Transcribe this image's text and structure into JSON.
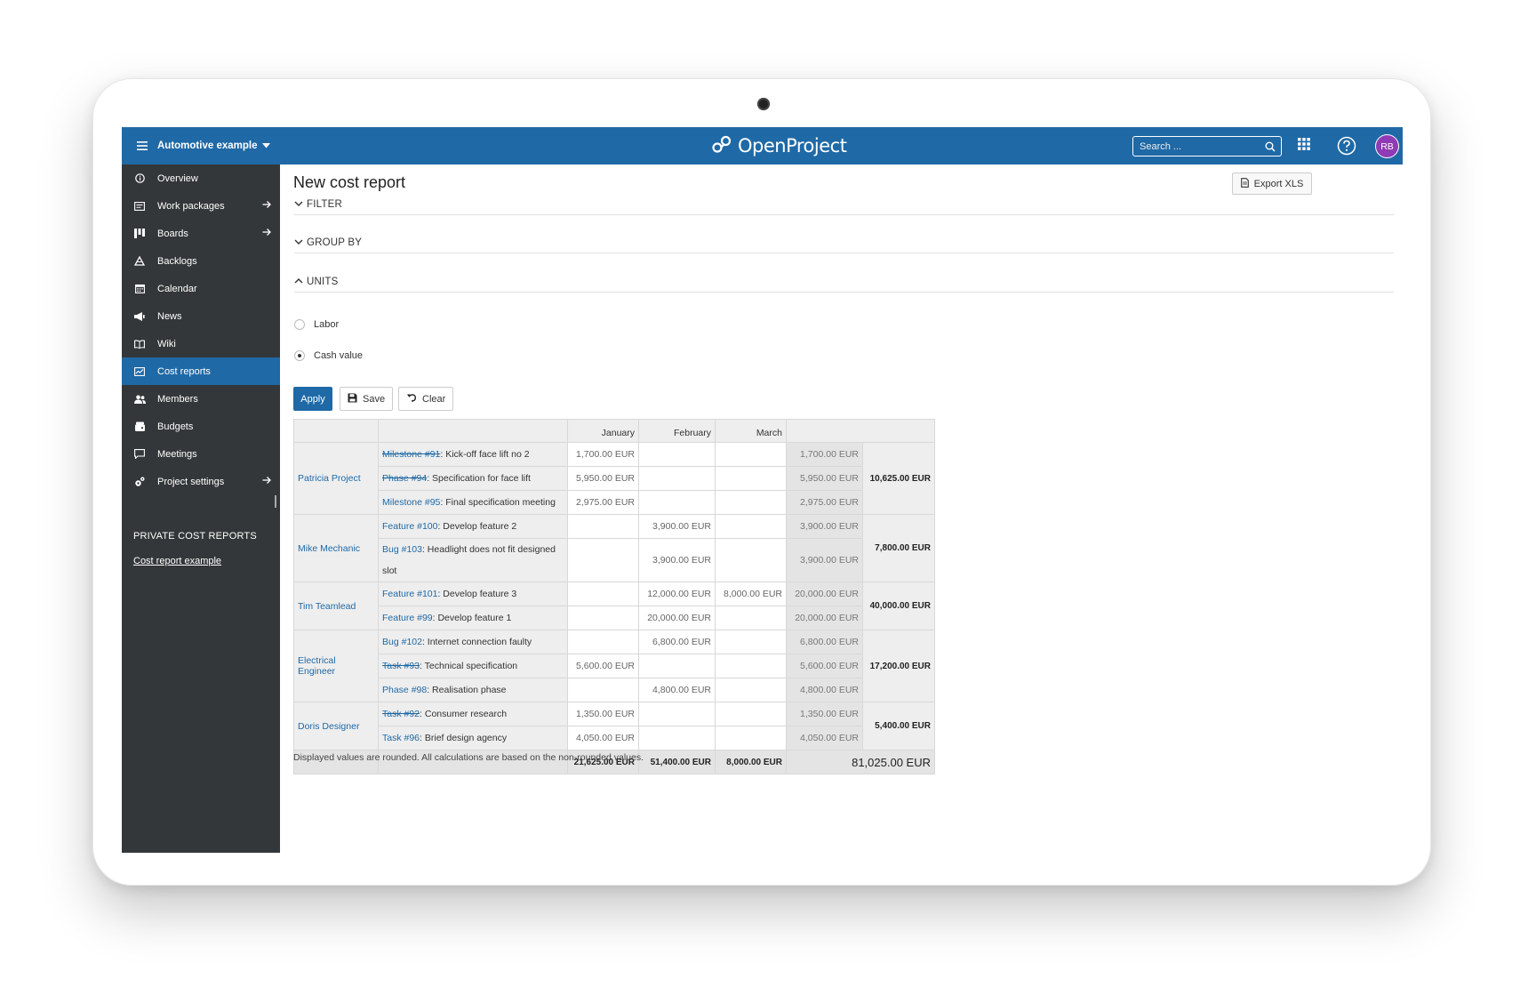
{
  "header": {
    "project_name": "Automotive example",
    "logo_text": "OpenProject",
    "search_placeholder": "Search ...",
    "avatar_initials": "RB"
  },
  "sidebar": {
    "items": [
      {
        "label": "Overview",
        "icon": "info-icon",
        "arrow": false,
        "active": false
      },
      {
        "label": "Work packages",
        "icon": "work-packages-icon",
        "arrow": true,
        "active": false
      },
      {
        "label": "Boards",
        "icon": "boards-icon",
        "arrow": true,
        "active": false
      },
      {
        "label": "Backlogs",
        "icon": "backlogs-icon",
        "arrow": false,
        "active": false
      },
      {
        "label": "Calendar",
        "icon": "calendar-icon",
        "arrow": false,
        "active": false
      },
      {
        "label": "News",
        "icon": "news-icon",
        "arrow": false,
        "active": false
      },
      {
        "label": "Wiki",
        "icon": "wiki-icon",
        "arrow": false,
        "active": false
      },
      {
        "label": "Cost reports",
        "icon": "cost-reports-icon",
        "arrow": false,
        "active": true
      },
      {
        "label": "Members",
        "icon": "members-icon",
        "arrow": false,
        "active": false
      },
      {
        "label": "Budgets",
        "icon": "budgets-icon",
        "arrow": false,
        "active": false
      },
      {
        "label": "Meetings",
        "icon": "meetings-icon",
        "arrow": false,
        "active": false
      },
      {
        "label": "Project settings",
        "icon": "settings-icon",
        "arrow": true,
        "active": false
      }
    ],
    "private_title": "PRIVATE COST REPORTS",
    "private_link": "Cost report example"
  },
  "main": {
    "title": "New cost report",
    "export_label": "Export XLS",
    "sections": {
      "filter": "FILTER",
      "group_by": "GROUP BY",
      "units": "UNITS"
    },
    "units": [
      {
        "label": "Labor",
        "selected": false
      },
      {
        "label": "Cash value",
        "selected": true
      }
    ],
    "buttons": {
      "apply": "Apply",
      "save": "Save",
      "clear": "Clear"
    },
    "note": "Displayed values are rounded. All calculations are based on the non-rounded values."
  },
  "report": {
    "columns": [
      "January",
      "February",
      "March"
    ],
    "groups": [
      {
        "name": "Patricia Project",
        "total": "10,625.00 EUR",
        "rows": [
          {
            "ref": "Milestone #91",
            "struck": true,
            "title": ": Kick-off face lift no 2",
            "jan": "1,700.00 EUR",
            "feb": "",
            "mar": "",
            "sum": "1,700.00 EUR"
          },
          {
            "ref": "Phase #94",
            "struck": true,
            "title": ": Specification for face lift",
            "jan": "5,950.00 EUR",
            "feb": "",
            "mar": "",
            "sum": "5,950.00 EUR"
          },
          {
            "ref": "Milestone #95",
            "struck": false,
            "title": ": Final specification meeting",
            "jan": "2,975.00 EUR",
            "feb": "",
            "mar": "",
            "sum": "2,975.00 EUR"
          }
        ]
      },
      {
        "name": "Mike Mechanic",
        "total": "7,800.00 EUR",
        "rows": [
          {
            "ref": "Feature #100",
            "struck": false,
            "title": ": Develop feature 2",
            "jan": "",
            "feb": "3,900.00 EUR",
            "mar": "",
            "sum": "3,900.00 EUR"
          },
          {
            "ref": "Bug #103",
            "struck": false,
            "title": ": Headlight does not fit designed slot",
            "jan": "",
            "feb": "3,900.00 EUR",
            "mar": "",
            "sum": "3,900.00 EUR",
            "tall": true
          }
        ]
      },
      {
        "name": "Tim Teamlead",
        "total": "40,000.00 EUR",
        "rows": [
          {
            "ref": "Feature #101",
            "struck": false,
            "title": ": Develop feature 3",
            "jan": "",
            "feb": "12,000.00 EUR",
            "mar": "8,000.00 EUR",
            "sum": "20,000.00 EUR"
          },
          {
            "ref": "Feature #99",
            "struck": false,
            "title": ": Develop feature 1",
            "jan": "",
            "feb": "20,000.00 EUR",
            "mar": "",
            "sum": "20,000.00 EUR"
          }
        ]
      },
      {
        "name": "Electrical Engineer",
        "total": "17,200.00 EUR",
        "rows": [
          {
            "ref": "Bug #102",
            "struck": false,
            "title": ": Internet connection faulty",
            "jan": "",
            "feb": "6,800.00 EUR",
            "mar": "",
            "sum": "6,800.00 EUR"
          },
          {
            "ref": "Task #93",
            "struck": true,
            "title": ": Technical specification",
            "jan": "5,600.00 EUR",
            "feb": "",
            "mar": "",
            "sum": "5,600.00 EUR"
          },
          {
            "ref": "Phase #98",
            "struck": false,
            "title": ": Realisation phase",
            "jan": "",
            "feb": "4,800.00 EUR",
            "mar": "",
            "sum": "4,800.00 EUR"
          }
        ]
      },
      {
        "name": "Doris Designer",
        "total": "5,400.00 EUR",
        "rows": [
          {
            "ref": "Task #92",
            "struck": true,
            "title": ": Consumer research",
            "jan": "1,350.00 EUR",
            "feb": "",
            "mar": "",
            "sum": "1,350.00 EUR"
          },
          {
            "ref": "Task #96",
            "struck": false,
            "title": ": Brief design agency",
            "jan": "4,050.00 EUR",
            "feb": "",
            "mar": "",
            "sum": "4,050.00 EUR"
          }
        ]
      }
    ],
    "totals": {
      "jan": "21,625.00 EUR",
      "feb": "51,400.00 EUR",
      "mar": "8,000.00 EUR",
      "grand": "81,025.00 EUR"
    }
  },
  "colors": {
    "header_blue": "#1f69a6",
    "sidebar_dark": "#333739",
    "avatar_purple": "#8e3bb5"
  }
}
